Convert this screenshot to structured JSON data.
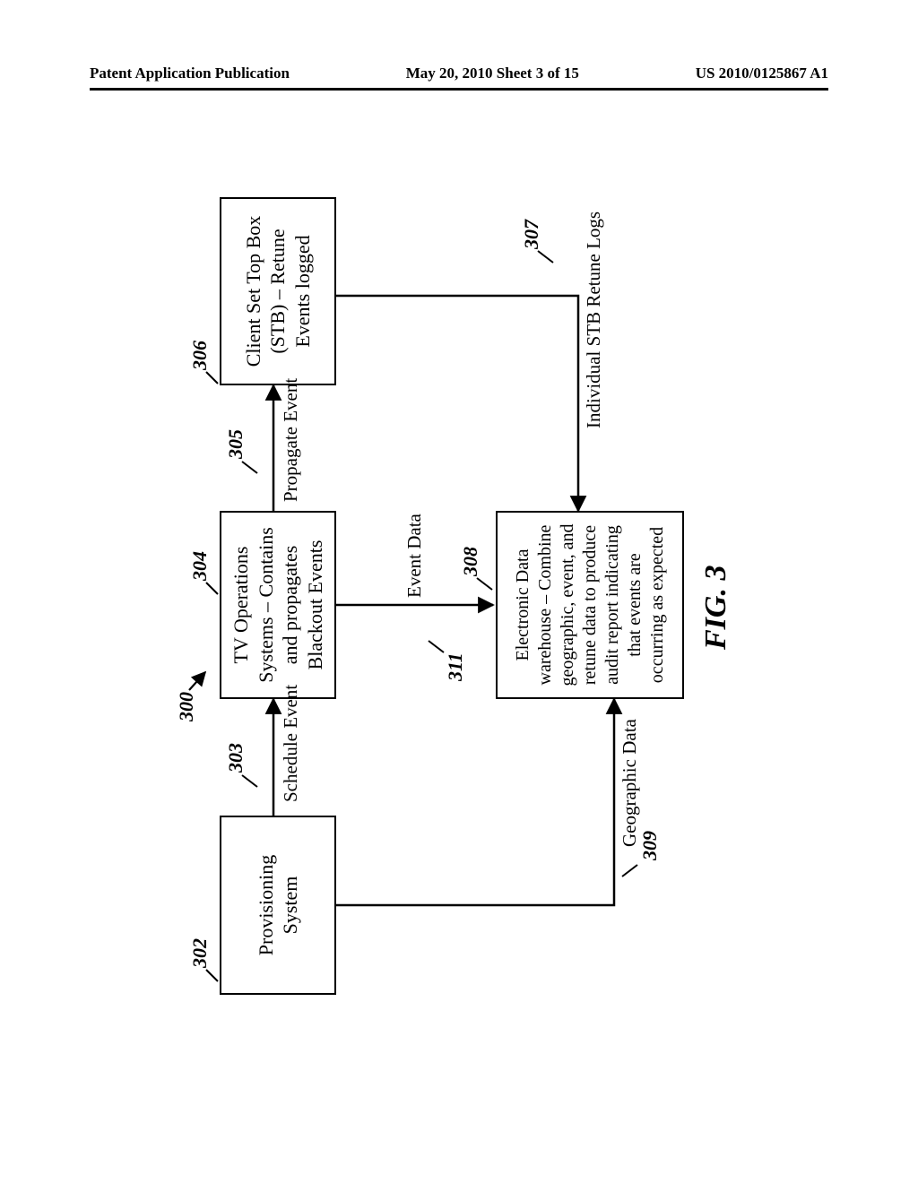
{
  "header": {
    "left": "Patent Application Publication",
    "center": "May 20, 2010  Sheet 3 of 15",
    "right": "US 2010/0125867 A1"
  },
  "fig": {
    "ref300": "300",
    "ref302": "302",
    "ref303": "303",
    "ref304": "304",
    "ref305": "305",
    "ref306": "306",
    "ref307": "307",
    "ref308": "308",
    "ref309": "309",
    "ref311": "311",
    "box_provisioning": "Provisioning System",
    "box_tvops": "TV Operations Systems – Contains and propagates Blackout Events",
    "box_stb": "Client Set Top Box (STB) – Retune Events logged",
    "box_edw": "Electronic Data warehouse – Combine geographic, event, and retune data to produce audit report indicating that events are occurring as expected",
    "edge_schedule": "Schedule Event",
    "edge_propagate": "Propagate Event",
    "edge_eventdata": "Event Data",
    "edge_geo": "Geographic Data",
    "edge_retune": "Individual STB Retune Logs",
    "caption": "FIG. 3"
  }
}
